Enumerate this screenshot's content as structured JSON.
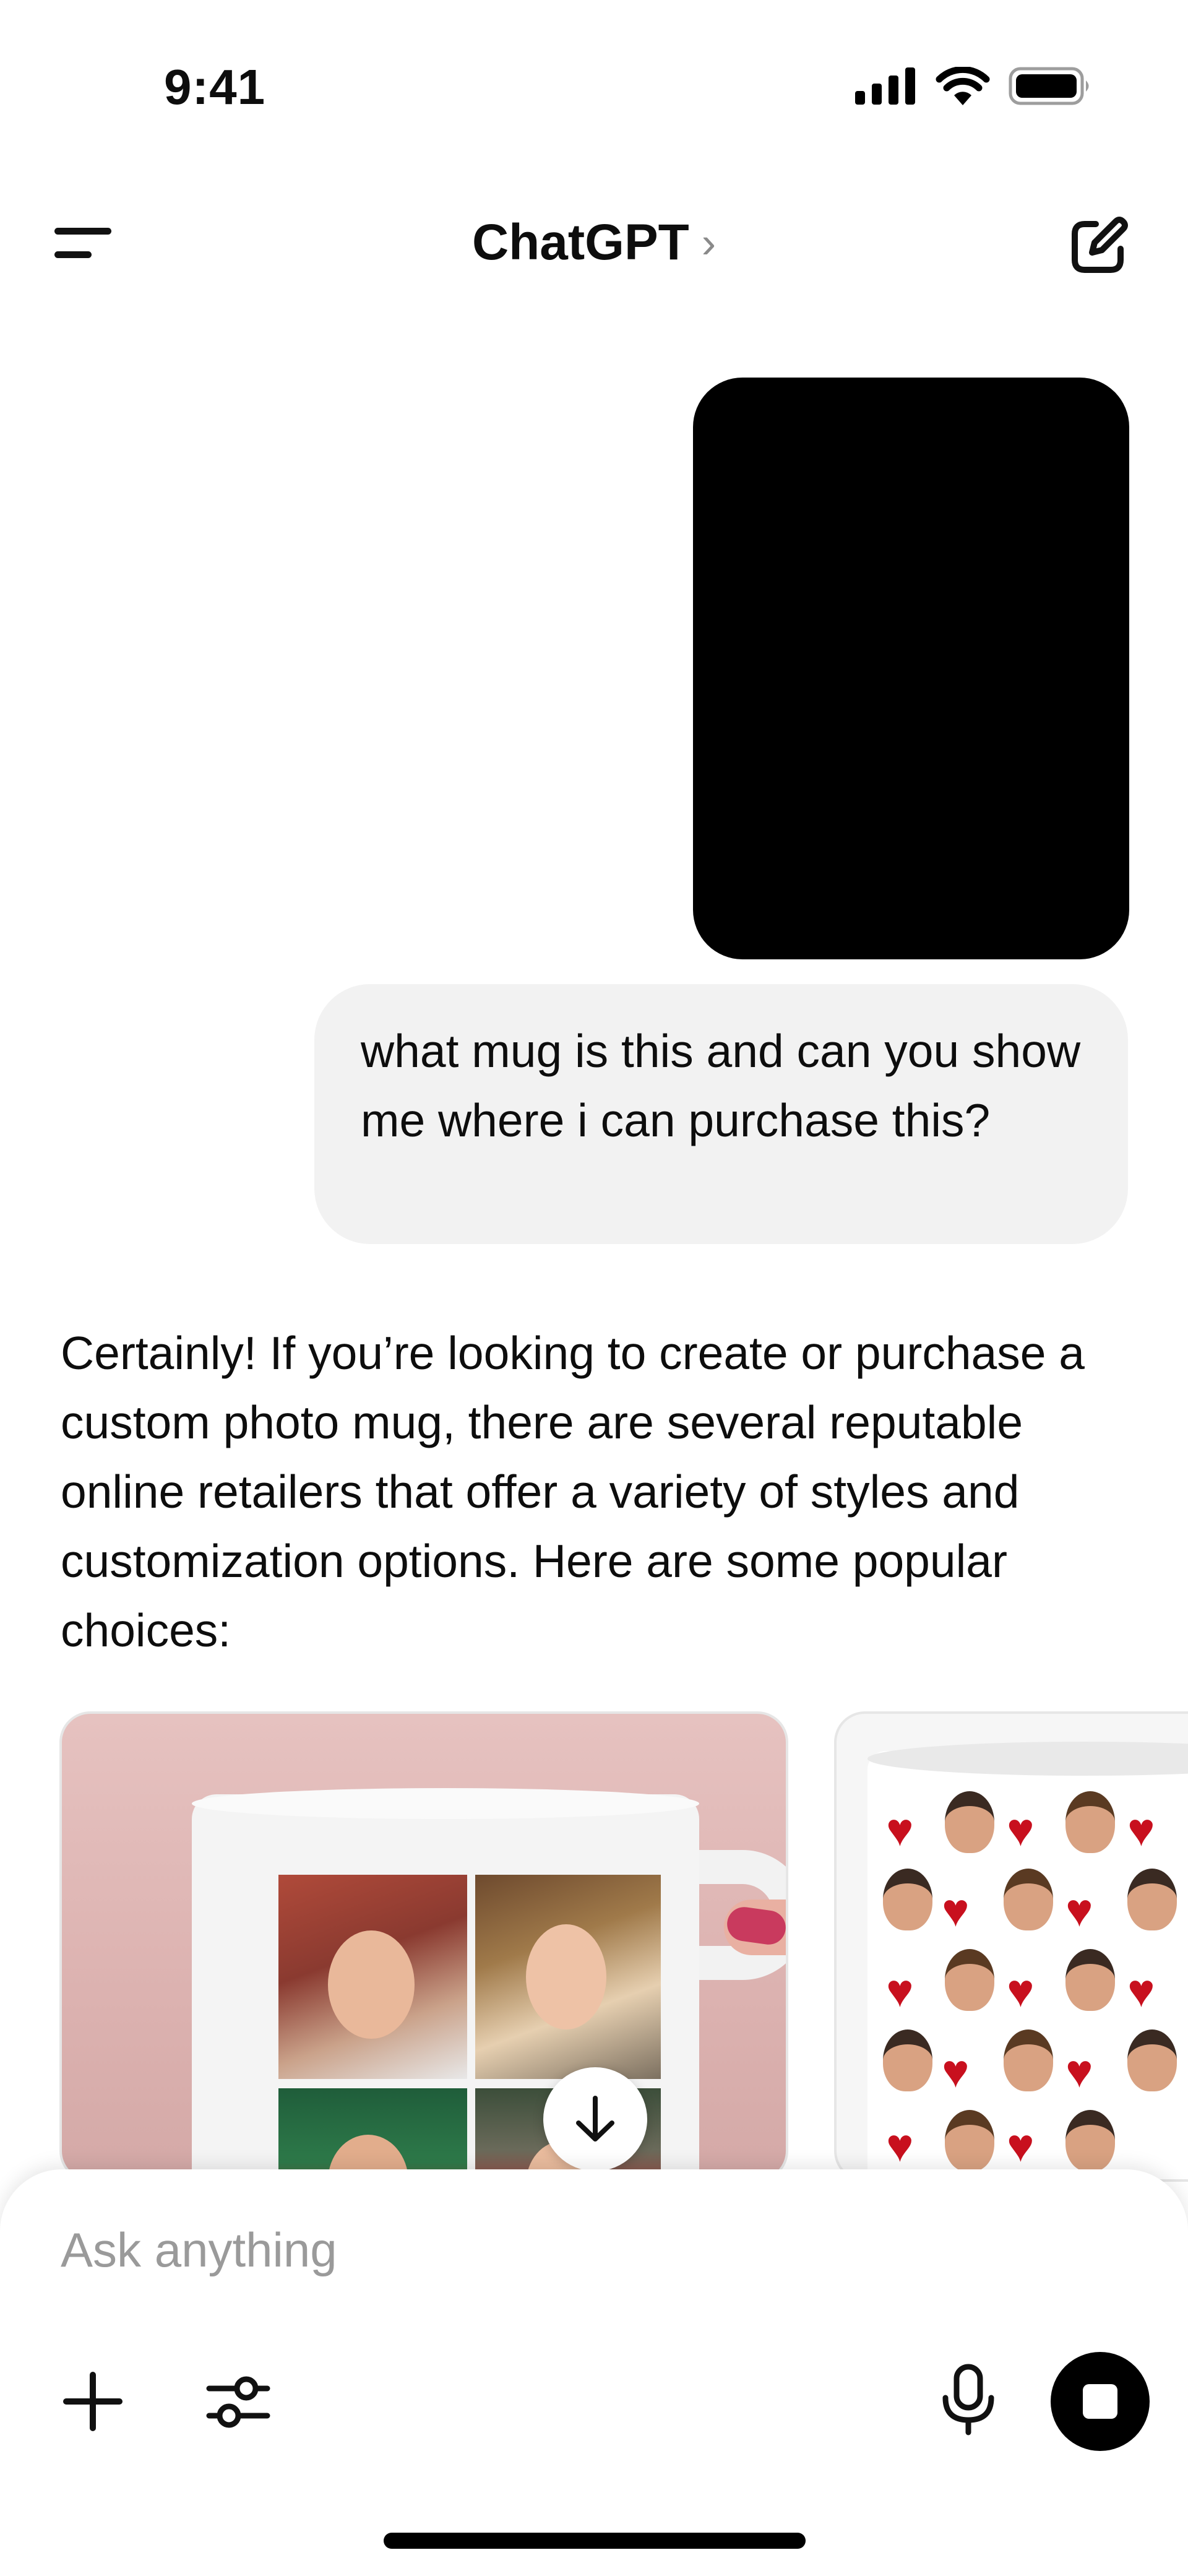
{
  "status_bar": {
    "time": "9:41",
    "icons": [
      "cellular-signal-icon",
      "wifi-icon",
      "battery-icon"
    ]
  },
  "header": {
    "title": "ChatGPT",
    "title_chevron": "›",
    "icons": [
      "menu-icon",
      "compose-icon"
    ]
  },
  "conversation": {
    "user_message": "what mug is this and can you show me where i can purchase this?",
    "assistant_message": "Certainly! If you’re looking to create or purchase a custom photo mug, there are several reputable online retailers that offer a variety of styles and customization options. Here are some popular choices:"
  },
  "carousel": {
    "items": [
      {
        "image": "photo-collage-mug"
      },
      {
        "image": "hearts-and-faces-pattern-mug"
      }
    ]
  },
  "composer": {
    "placeholder": "Ask anything",
    "value": "",
    "icons": [
      "plus-icon",
      "tools-icon",
      "microphone-icon",
      "stop-icon"
    ]
  },
  "colors": {
    "accent": "#000000",
    "bubble_bg": "#f2f2f2",
    "placeholder": "#9a9a9a"
  }
}
